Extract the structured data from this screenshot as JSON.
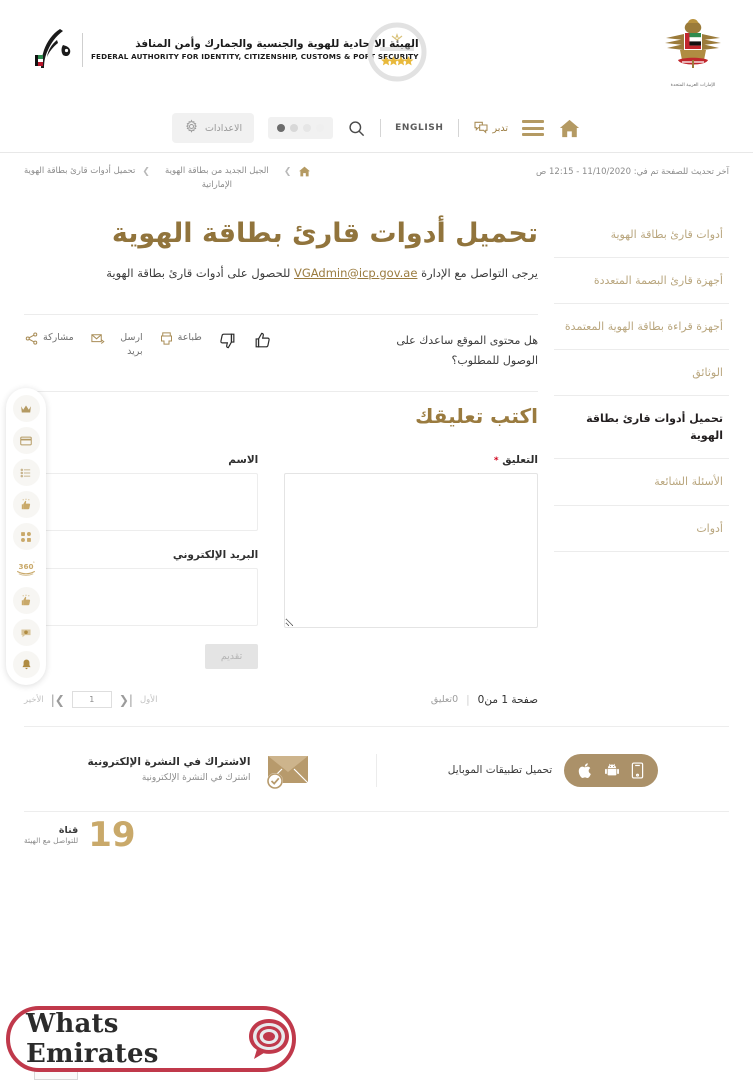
{
  "header": {
    "logo": {
      "arabic": "الهيئة الاتحادية للهوية والجنسية والجمارك وأمن المنافذ",
      "english": "FEDERAL AUTHORITY FOR IDENTITY, CITIZENSHIP, CUSTOMS & PORT SECURITY",
      "icon": "falcon-logo-icon"
    },
    "medal": {
      "icon": "four-star-medal-icon",
      "stars": 4
    },
    "emblem": {
      "icon": "uae-federal-emblem-icon",
      "caption": "الإمارات العربية المتحدة"
    }
  },
  "nav": {
    "settings_label": "الاعدادات",
    "settings_icon": "gear-icon",
    "contrast_icon": "contrast-dots-icon",
    "search_icon": "search-icon",
    "english_label": "ENGLISH",
    "tadabbor_label": "تدبر",
    "tadabbor_icon": "chat-bubbles-icon",
    "menu_icon": "hamburger-menu-icon",
    "home_icon": "home-icon"
  },
  "breadcrumb": {
    "home_icon": "home-icon",
    "items": [
      {
        "label": "الجيل الجديد من بطاقة الهوية الإماراتية"
      },
      {
        "label": "تحميل أدوات قارئ بطاقة الهوية"
      }
    ],
    "separator": "❯"
  },
  "last_update": "آخر تحديث للصفحة تم في: 11/10/2020 - 12:15 ص",
  "sidebar": {
    "items": [
      {
        "label": "أدوات قارئ بطاقة الهوية",
        "active": false
      },
      {
        "label": "أجهزة قارئ البصمة المتعددة",
        "active": false
      },
      {
        "label": "أجهزة قراءة بطاقة الهوية المعتمدة",
        "active": false
      },
      {
        "label": "الوثائق",
        "active": false
      },
      {
        "label": "تحميل أدوات قارئ بطاقة الهوية",
        "active": true
      },
      {
        "label": "الأسئلة الشائعة",
        "active": false
      },
      {
        "label": "أدوات",
        "active": false
      }
    ]
  },
  "main": {
    "title": "تحميل أدوات قارئ بطاقة الهوية",
    "intro_before": "يرجى التواصل مع الإدارة ",
    "intro_email": "VGAdmin@icp.gov.ae",
    "intro_after": " للحصول على أدوات قارئ بطاقة الهوية"
  },
  "feedback": {
    "question": "هل محتوى الموقع ساعدك على الوصول للمطلوب؟",
    "thumbs_up_icon": "thumbs-up-icon",
    "thumbs_down_icon": "thumbs-down-icon",
    "actions": [
      {
        "label": "طباعة",
        "icon": "printer-icon"
      },
      {
        "label": "ارسل بريد",
        "icon": "mail-send-icon"
      },
      {
        "label": "مشاركة",
        "icon": "share-icon"
      }
    ]
  },
  "comment_form": {
    "heading": "اكتب تعليقك",
    "comment_label": "التعليق",
    "required_mark": "*",
    "comment_value": "",
    "name_label": "الاسم",
    "name_value": "",
    "email_label": "البريد الإلكتروني",
    "email_value": "",
    "submit_label": "تقديم"
  },
  "pagination": {
    "page_info": "صفحة 1 من0",
    "comment_count": "0تعليق",
    "divider": "|",
    "first_label": "الأول",
    "last_label": "الأخير",
    "current_page": "1",
    "next_icon": "chevron-right-last-icon",
    "prev_icon": "chevron-left-first-icon"
  },
  "footer": {
    "apps": {
      "label": "تحميل تطبيقات الموبايل",
      "icons": [
        "phone-icon",
        "android-icon",
        "apple-icon"
      ]
    },
    "newsletter": {
      "title": "الاشتراك في النشرة الإلكترونية",
      "subtitle": "اشترك في النشرة الإلكترونية",
      "icon": "envelope-check-icon"
    },
    "channel": {
      "number": "19",
      "title": "قناة",
      "subtitle": "للتواصل مع الهيئة"
    }
  },
  "float_toolbar": {
    "items": [
      {
        "icon": "crown-icon"
      },
      {
        "icon": "card-icon"
      },
      {
        "icon": "list-icon"
      },
      {
        "icon": "rating-thumb-icon"
      },
      {
        "icon": "services-icon"
      },
      {
        "icon": "360-badge-icon"
      },
      {
        "icon": "rating-thumb-icon"
      },
      {
        "icon": "support-chat-icon"
      },
      {
        "icon": "bell-icon"
      }
    ]
  },
  "watermark": {
    "text": "Whats Emirates",
    "icon": "speech-bubble-logo-icon",
    "border_color": "#c0394b"
  },
  "colors": {
    "gold": "#9a7b3f",
    "gold_light": "#b9a67e",
    "tan": "#ab9169",
    "channel_gold": "#c9a96a",
    "required_red": "#d0021b",
    "watermark_red": "#c0394b"
  }
}
